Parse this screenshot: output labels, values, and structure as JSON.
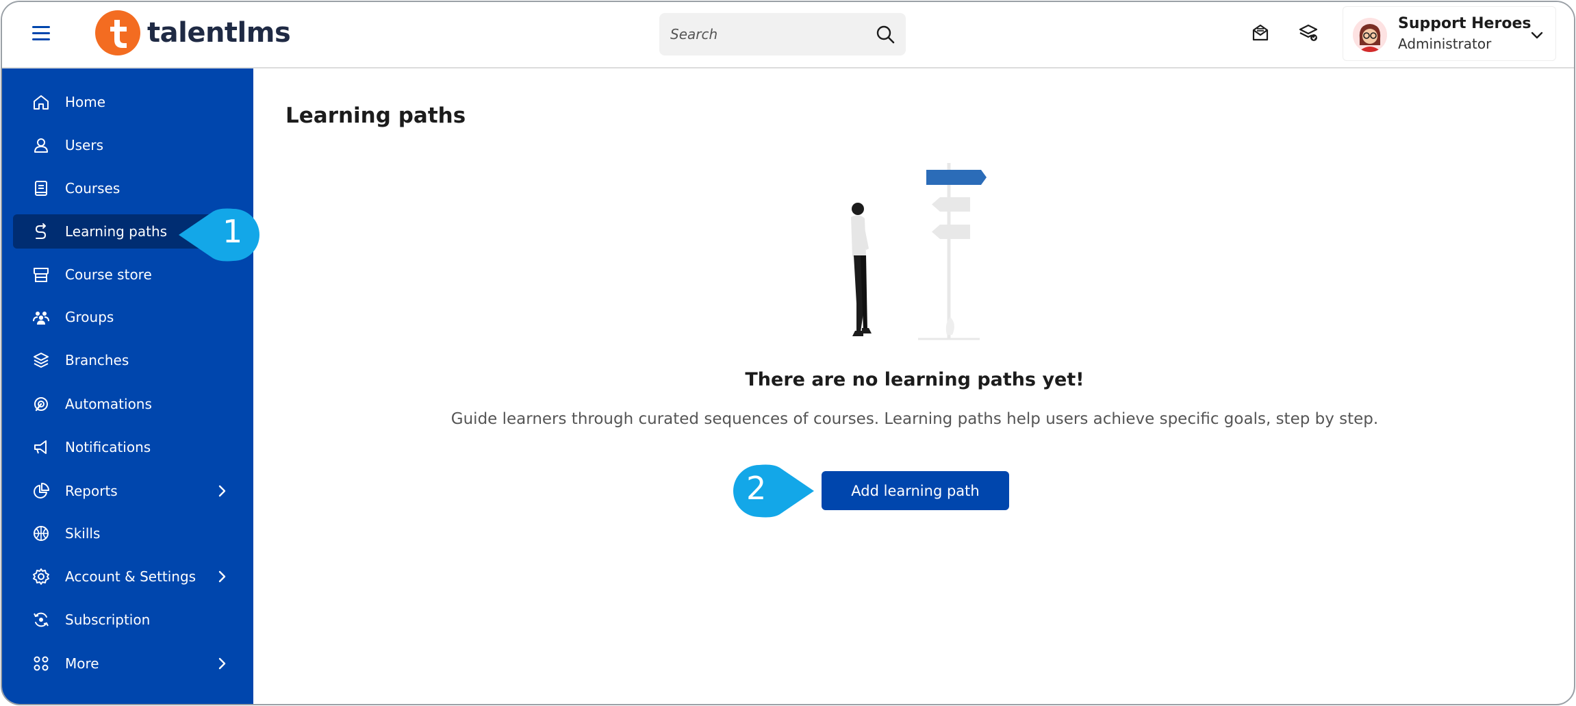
{
  "app": {
    "logo_text": "talentlms"
  },
  "header": {
    "search_placeholder": "Search",
    "user_name": "Support Heroes",
    "user_role": "Administrator"
  },
  "sidebar": {
    "items": [
      {
        "label": "Home",
        "icon": "home-icon"
      },
      {
        "label": "Users",
        "icon": "user-icon"
      },
      {
        "label": "Courses",
        "icon": "book-icon"
      },
      {
        "label": "Learning paths",
        "icon": "route-icon",
        "active": true
      },
      {
        "label": "Course store",
        "icon": "store-icon"
      },
      {
        "label": "Groups",
        "icon": "group-icon"
      },
      {
        "label": "Branches",
        "icon": "layers-icon"
      },
      {
        "label": "Automations",
        "icon": "automation-icon"
      },
      {
        "label": "Notifications",
        "icon": "megaphone-icon"
      },
      {
        "label": "Reports",
        "icon": "pie-chart-icon",
        "has_submenu": true
      },
      {
        "label": "Skills",
        "icon": "skills-icon"
      },
      {
        "label": "Account & Settings",
        "icon": "gear-icon",
        "has_submenu": true
      },
      {
        "label": "Subscription",
        "icon": "subscription-icon"
      },
      {
        "label": "More",
        "icon": "grid-icon",
        "has_submenu": true
      }
    ]
  },
  "main": {
    "page_title": "Learning paths",
    "empty_title": "There are no learning paths yet!",
    "empty_description": "Guide learners through curated sequences of courses. Learning paths help users achieve specific goals, step by step.",
    "add_button_label": "Add learning path"
  },
  "callouts": [
    {
      "number": "1"
    },
    {
      "number": "2"
    }
  ],
  "colors": {
    "brand_blue": "#0046ad",
    "active_item": "#002d72",
    "logo_orange": "#f36c21",
    "callout": "#13a7e8"
  }
}
